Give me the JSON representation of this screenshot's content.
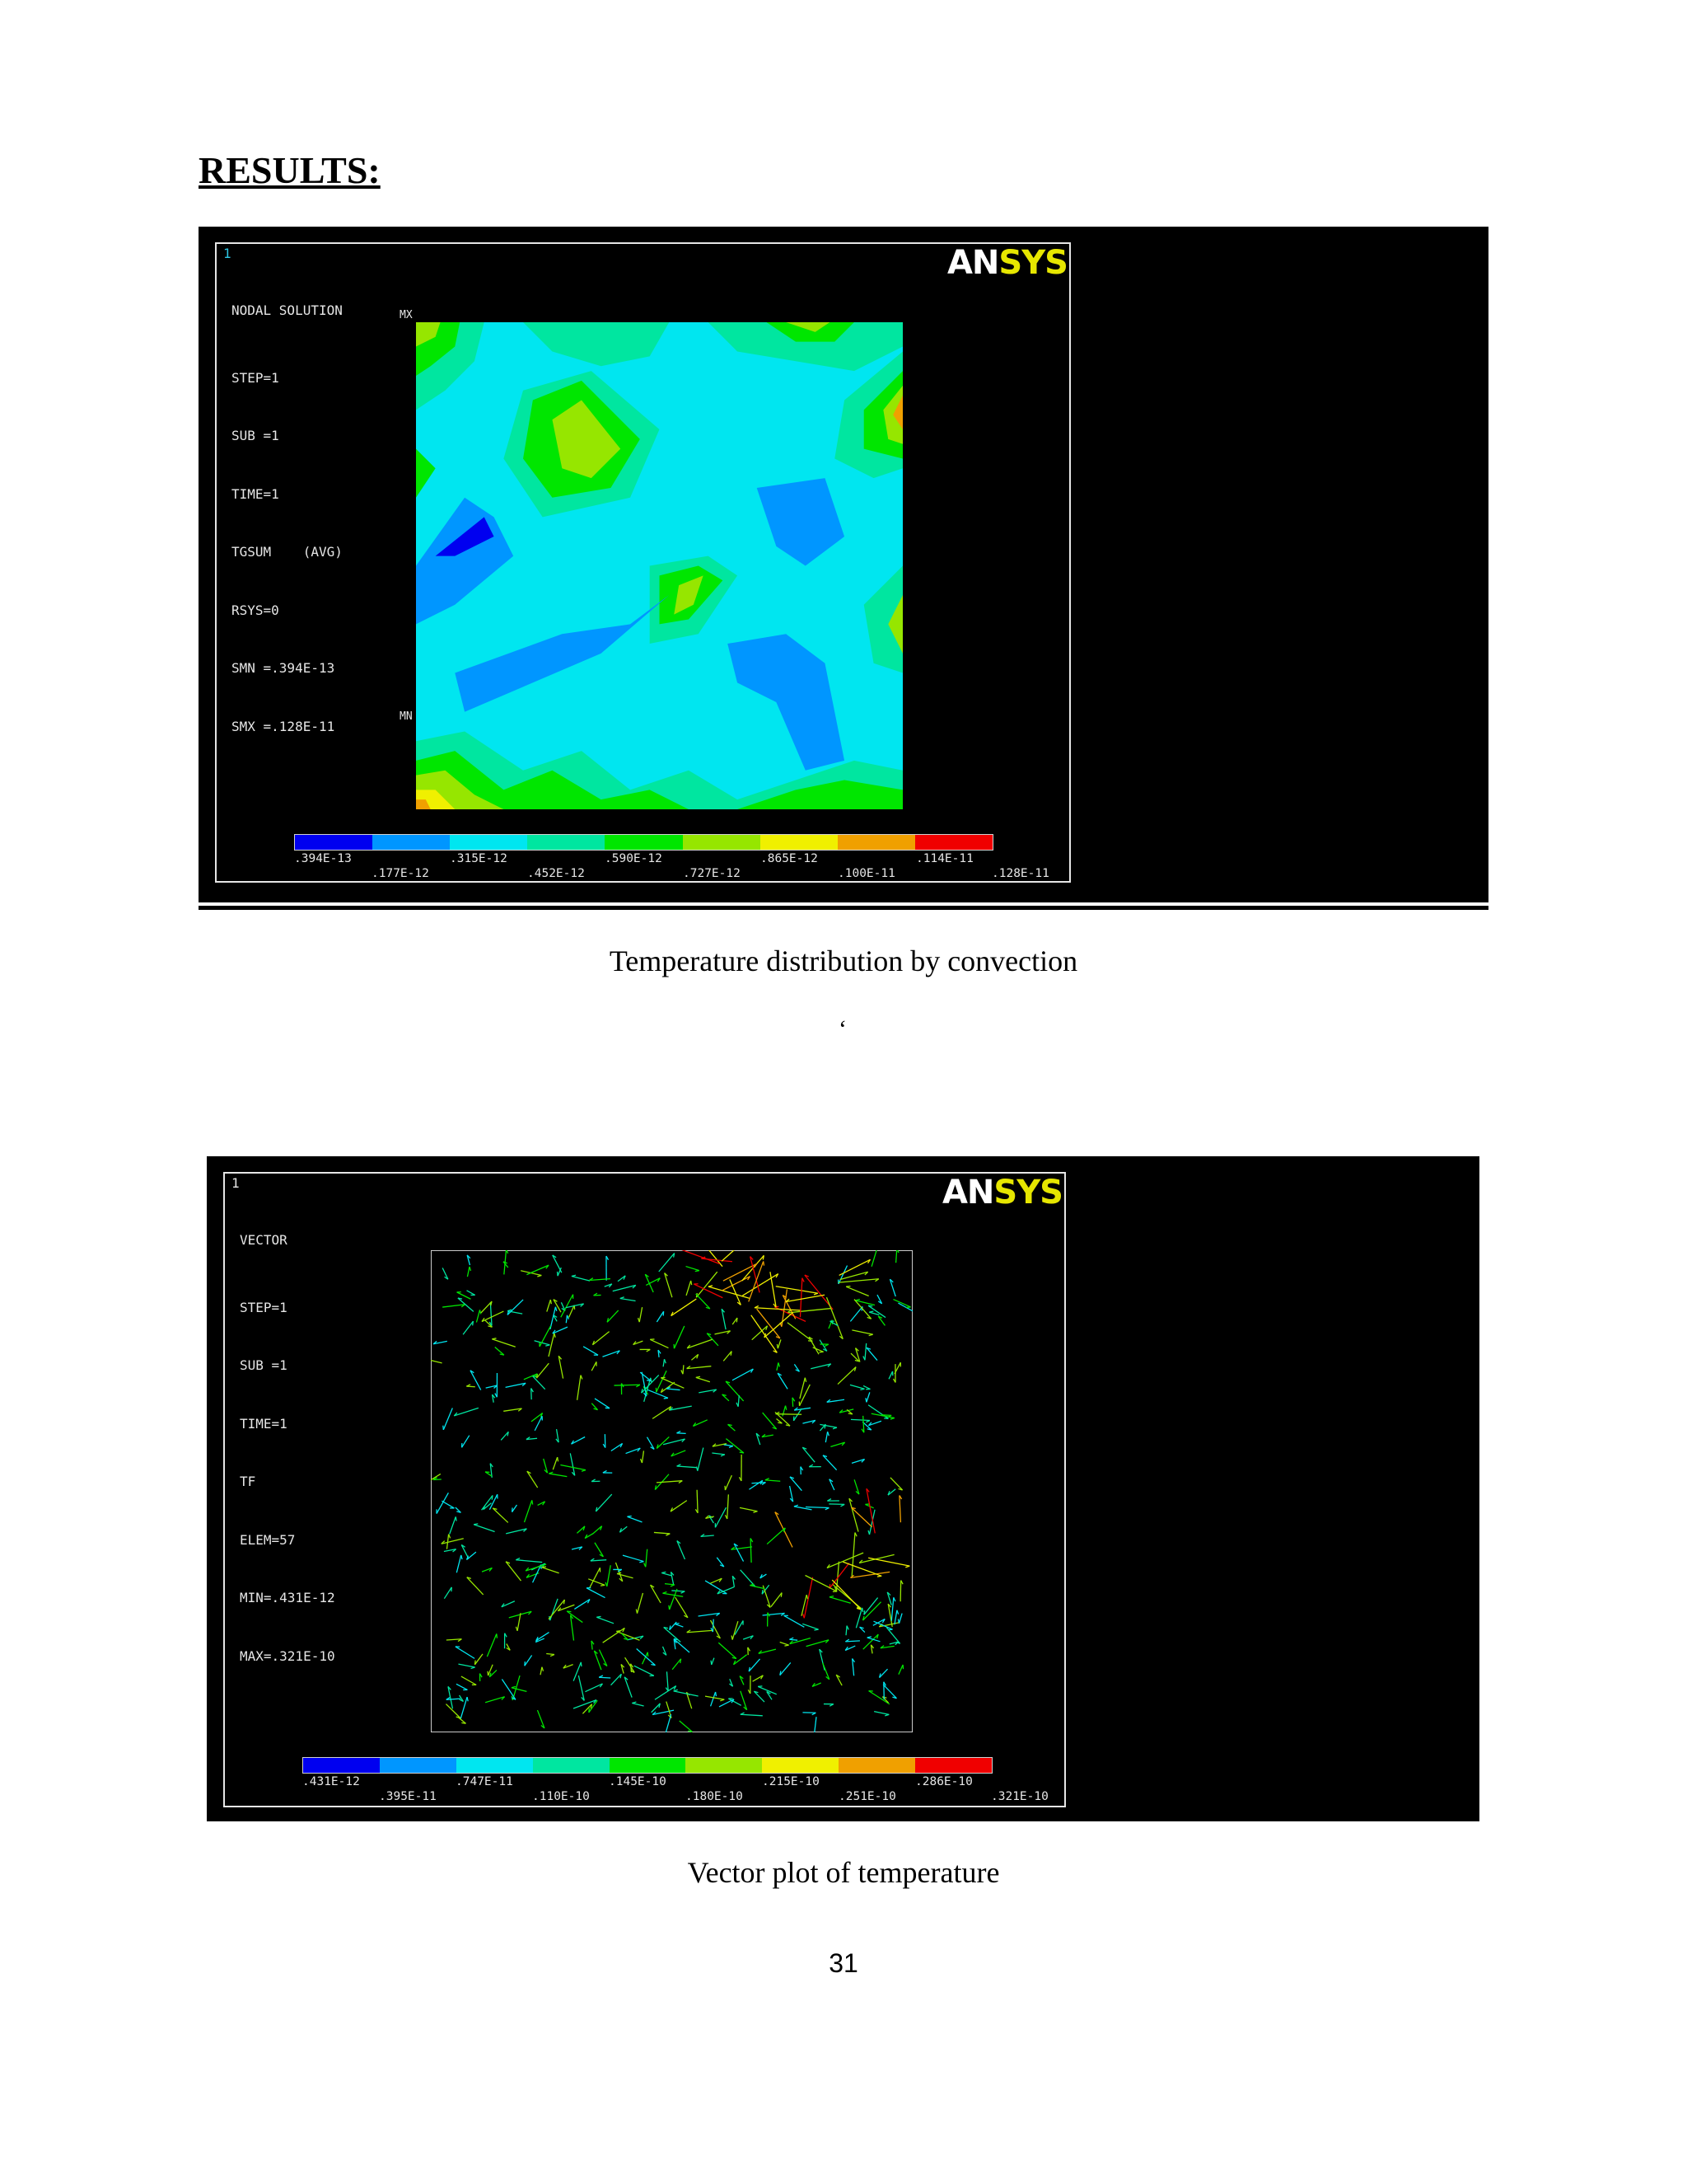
{
  "heading": "RESULTS:",
  "figure1": {
    "window_number": "1",
    "logo_an": "AN",
    "logo_sys": "SYS",
    "info_title": "NODAL SOLUTION",
    "info_lines": [
      "STEP=1",
      "SUB =1",
      "TIME=1",
      "TGSUM    (AVG)",
      "RSYS=0",
      "SMN =.394E-13",
      "SMX =.128E-11"
    ],
    "max_marker": "MX",
    "min_marker": "MN",
    "legend_colors": [
      "#0000f0",
      "#0096ff",
      "#00e6f0",
      "#00e6a0",
      "#00e600",
      "#96e600",
      "#f0f000",
      "#f0a000",
      "#f00000"
    ],
    "legend_ticks_upper": [
      ".394E-13",
      ".315E-12",
      ".590E-12",
      ".865E-12",
      ".114E-11"
    ],
    "legend_ticks_lower": [
      ".177E-12",
      ".452E-12",
      ".727E-12",
      ".100E-11",
      ".128E-11"
    ],
    "caption": "Temperature distribution by convection"
  },
  "stray_mark": "‘",
  "figure2": {
    "window_number": "1",
    "logo_an": "AN",
    "logo_sys": "SYS",
    "info_title": "VECTOR",
    "info_lines": [
      "STEP=1",
      "SUB =1",
      "TIME=1",
      "TF",
      "ELEM=57",
      "MIN=.431E-12",
      "MAX=.321E-10"
    ],
    "legend_colors": [
      "#0000f0",
      "#0096ff",
      "#00e6f0",
      "#00e6a0",
      "#00e600",
      "#96e600",
      "#f0f000",
      "#f0a000",
      "#f00000"
    ],
    "legend_ticks_upper": [
      ".431E-12",
      ".747E-11",
      ".145E-10",
      ".215E-10",
      ".286E-10"
    ],
    "legend_ticks_lower": [
      ".395E-11",
      ".110E-10",
      ".180E-10",
      ".251E-10",
      ".321E-10"
    ],
    "caption": "Vector plot of temperature"
  },
  "page_number": "31"
}
